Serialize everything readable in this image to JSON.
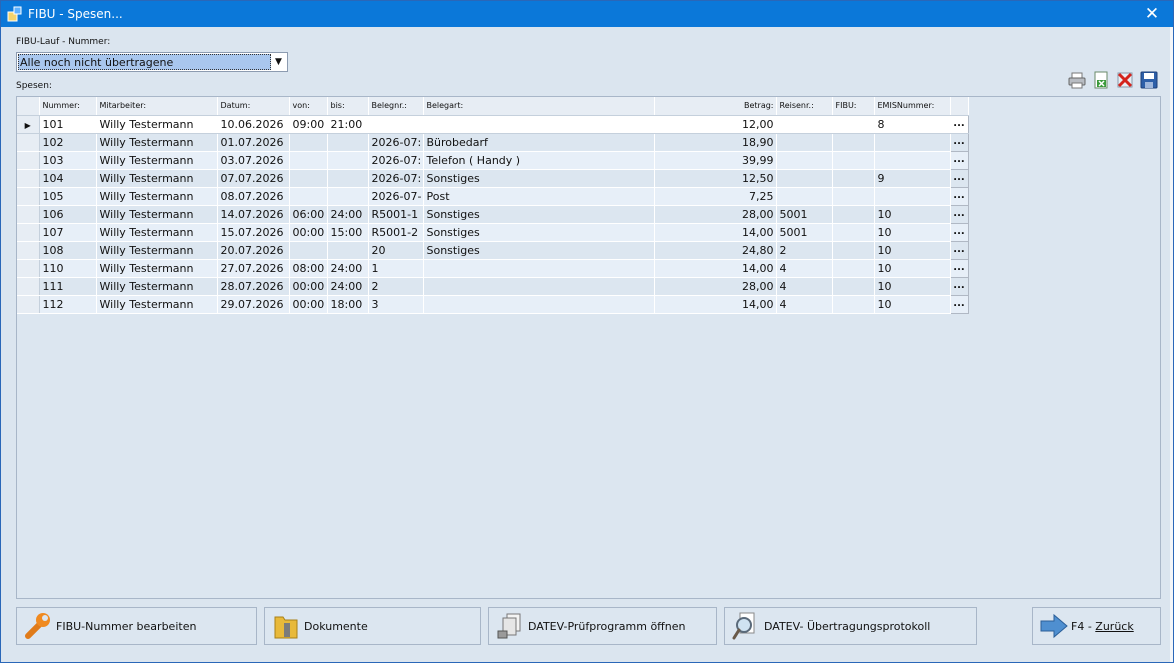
{
  "window": {
    "title": "FIBU - Spesen..."
  },
  "fibu": {
    "label": "FIBU-Lauf - Nummer:",
    "selected": "Alle noch nicht übertragene"
  },
  "spesen": {
    "label": "Spesen:",
    "columns": [
      "Nummer:",
      "Mitarbeiter:",
      "Datum:",
      "von:",
      "bis:",
      "Belegnr.:",
      "Belegart:",
      "Betrag:",
      "Reisenr.:",
      "FIBU:",
      "EMISNummer:"
    ],
    "rows": [
      [
        "101",
        "Willy Testermann",
        "10.06.2026",
        "09:00",
        "21:00",
        "",
        "",
        "12,00",
        "",
        "",
        "8"
      ],
      [
        "102",
        "Willy Testermann",
        "01.07.2026",
        "",
        "",
        "2026-07:",
        "Bürobedarf",
        "18,90",
        "",
        "",
        ""
      ],
      [
        "103",
        "Willy Testermann",
        "03.07.2026",
        "",
        "",
        "2026-07:",
        "Telefon ( Handy )",
        "39,99",
        "",
        "",
        ""
      ],
      [
        "104",
        "Willy Testermann",
        "07.07.2026",
        "",
        "",
        "2026-07:",
        "Sonstiges",
        "12,50",
        "",
        "",
        "9"
      ],
      [
        "105",
        "Willy Testermann",
        "08.07.2026",
        "",
        "",
        "2026-07-",
        "Post",
        "7,25",
        "",
        "",
        ""
      ],
      [
        "106",
        "Willy Testermann",
        "14.07.2026",
        "06:00",
        "24:00",
        "R5001-1",
        "Sonstiges",
        "28,00",
        "5001",
        "",
        "10"
      ],
      [
        "107",
        "Willy Testermann",
        "15.07.2026",
        "00:00",
        "15:00",
        "R5001-2",
        "Sonstiges",
        "14,00",
        "5001",
        "",
        "10"
      ],
      [
        "108",
        "Willy Testermann",
        "20.07.2026",
        "",
        "",
        "20",
        "Sonstiges",
        "24,80",
        "2",
        "",
        "10"
      ],
      [
        "110",
        "Willy Testermann",
        "27.07.2026",
        "08:00",
        "24:00",
        "1",
        "",
        "14,00",
        "4",
        "",
        "10"
      ],
      [
        "111",
        "Willy Testermann",
        "28.07.2026",
        "00:00",
        "24:00",
        "2",
        "",
        "28,00",
        "4",
        "",
        "10"
      ],
      [
        "112",
        "Willy Testermann",
        "29.07.2026",
        "00:00",
        "18:00",
        "3",
        "",
        "14,00",
        "4",
        "",
        "10"
      ]
    ],
    "row_button": "..."
  },
  "buttons": {
    "fibu_edit": "FIBU-Nummer bearbeiten",
    "dokumente": "Dokumente",
    "datev_check": "DATEV-Prüfprogramm öffnen",
    "datev_protocol": "DATEV- Übertragungsprotokoll",
    "back_key": "F4 - ",
    "back_label": "Zurück"
  },
  "icons": [
    "app-icon",
    "close-icon",
    "printer-icon",
    "excel-export-icon",
    "delete-icon",
    "save-icon",
    "wrench-icon",
    "folder-icon",
    "documents-icon",
    "magnifier-icon",
    "arrow-right-icon",
    "row-indicator-icon"
  ],
  "colors": {
    "titlebar": "#0b78d9",
    "window_bg": "#dbe5ef",
    "selection": "#a9c7ee"
  }
}
